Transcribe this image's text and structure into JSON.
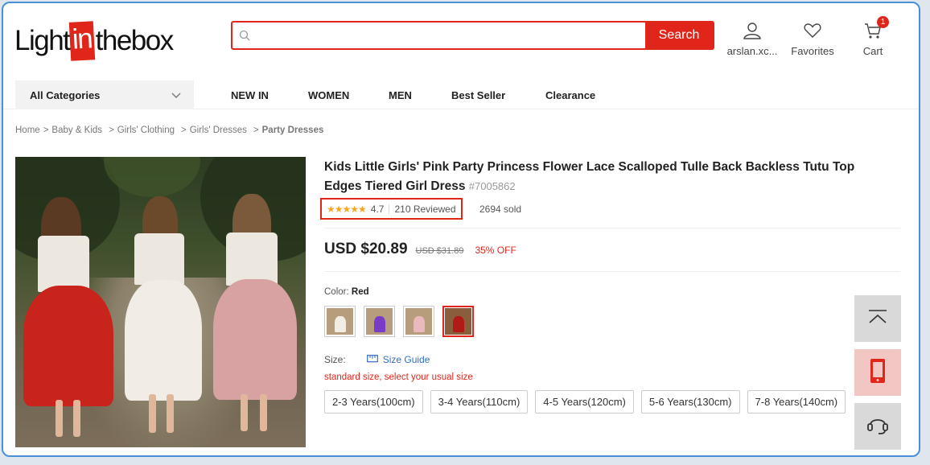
{
  "header": {
    "logo": {
      "pre": "Light",
      "box": "in",
      "post": "thebox"
    },
    "search": {
      "placeholder": "",
      "button": "Search"
    },
    "account_label": "arslan.xc...",
    "favorites_label": "Favorites",
    "cart_label": "Cart",
    "cart_count": "1"
  },
  "nav": {
    "all_categories": "All Categories",
    "items": [
      "NEW IN",
      "WOMEN",
      "MEN",
      "Best Seller",
      "Clearance"
    ]
  },
  "breadcrumb": {
    "items": [
      "Home",
      "Baby & Kids",
      "Girls' Clothing",
      "Girls' Dresses"
    ],
    "current": "Party Dresses",
    "separator": ">"
  },
  "product": {
    "title": "Kids Little Girls' Pink Party Princess Flower Lace Scalloped Tulle Back Backless Tutu Top Edges Tiered Girl Dress",
    "sku": "#7005862",
    "stars": "★★★★★",
    "rating": "4.7",
    "reviews": "210 Reviewed",
    "sold": "2694 sold",
    "price": "USD $20.89",
    "original_price": "USD $31.89",
    "discount": "35% OFF",
    "color_label": "Color:",
    "color_value": "Red",
    "swatches": [
      {
        "name": "white",
        "color": "#f1ece4"
      },
      {
        "name": "purple",
        "color": "#7a3cc7"
      },
      {
        "name": "pink",
        "color": "#e9b9bd"
      },
      {
        "name": "red",
        "color": "#b01a17"
      }
    ],
    "size_label": "Size:",
    "size_guide": "Size Guide",
    "size_hint": "standard size, select your usual size",
    "sizes": [
      "2-3 Years(100cm)",
      "3-4 Years(110cm)",
      "4-5 Years(120cm)",
      "5-6 Years(130cm)",
      "7-8 Years(140cm)"
    ]
  },
  "colors": {
    "brand_red": "#e0261b",
    "link_blue": "#2f6ec6",
    "star": "#f5a623"
  }
}
